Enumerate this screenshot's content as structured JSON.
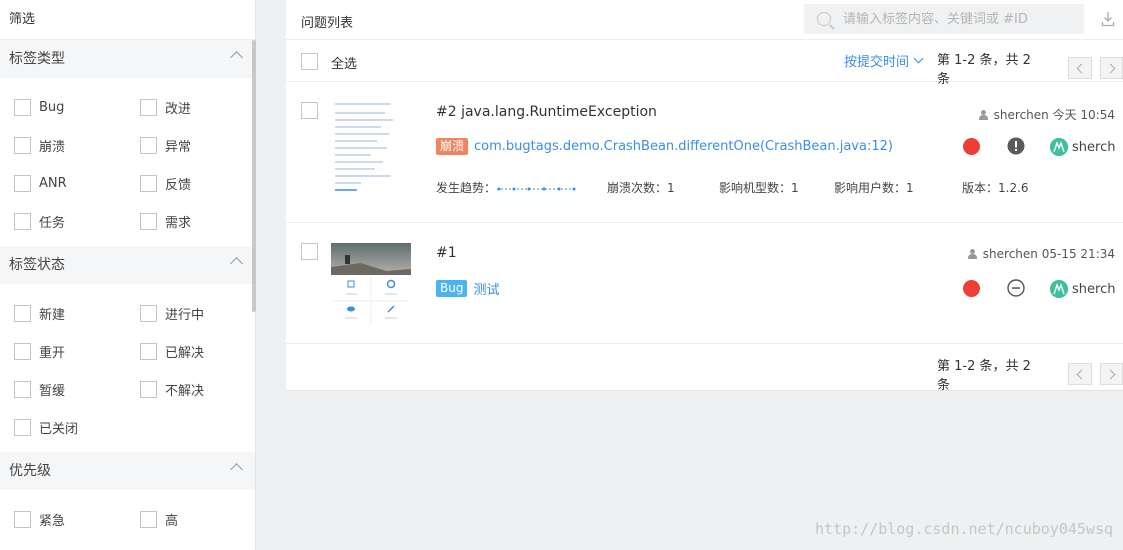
{
  "sidebar": {
    "title": "筛选",
    "sections": [
      {
        "label": "标签类型",
        "options": [
          "Bug",
          "改进",
          "崩溃",
          "异常",
          "ANR",
          "反馈",
          "任务",
          "需求"
        ]
      },
      {
        "label": "标签状态",
        "options": [
          "新建",
          "进行中",
          "重开",
          "已解决",
          "暂缓",
          "不解决",
          "已关闭"
        ]
      },
      {
        "label": "优先级",
        "options": [
          "紧急",
          "高"
        ]
      }
    ]
  },
  "main": {
    "title": "问题列表",
    "search_placeholder": "请输入标签内容、关键词或 #ID",
    "select_all": "全选",
    "sort_label": "按提交时间",
    "pagination": "第 1-2 条，共 2 条",
    "issues": [
      {
        "title": "#2 java.lang.RuntimeException",
        "author": "sherchen",
        "time": "今天 10:54",
        "tag": "崩溃",
        "description": "com.bugtags.demo.CrashBean.differentOne(CrashBean.java:12)",
        "trend_label": "发生趋势：",
        "crash_count": "崩溃次数：1",
        "device_count": "影响机型数：1",
        "user_count": "影响用户数：1",
        "version": "版本：1.2.6",
        "assignee": "sherch",
        "priority_color": "#ef3e36",
        "status_icon": "exclamation-icon"
      },
      {
        "title": "#1",
        "author": "sherchen",
        "time": "05-15 21:34",
        "tag": "Bug",
        "description": "测试",
        "assignee": "sherch",
        "priority_color": "#ef3e36",
        "status_icon": "minus-circle-icon"
      }
    ]
  },
  "watermark": "http://blog.csdn.net/ncuboy045wsq",
  "colors": {
    "accent": "#3a8ee6",
    "crash_tag": "#f0865f",
    "bug_tag": "#4ab4f0",
    "priority": "#ef3e36",
    "avatar": "#3dbfa0"
  }
}
